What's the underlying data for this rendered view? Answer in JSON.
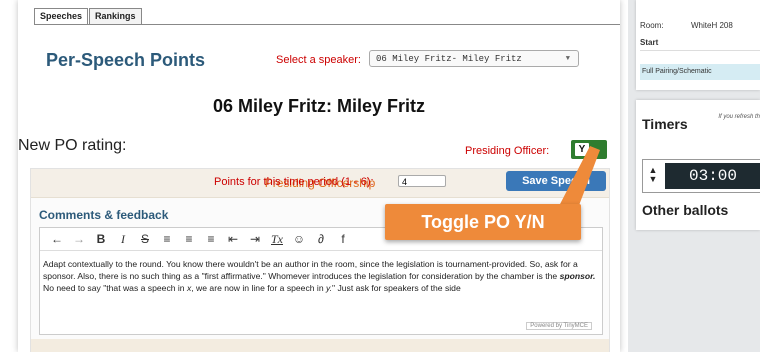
{
  "tabs": [
    {
      "label": "Speeches",
      "active": true
    },
    {
      "label": "Rankings",
      "active": false
    }
  ],
  "section_title": "Per-Speech Points",
  "speaker_select": {
    "label": "Select a speaker:",
    "value": "06 Miley Fritz- Miley Fritz"
  },
  "speech_heading": "06 Miley Fritz: Miley Fritz",
  "po_rating_label": "New PO rating:",
  "presiding_officer": {
    "label": "Presiding Officer:",
    "toggle_value": "Y",
    "color": "#2f7d2f"
  },
  "box_header": "Presiding Officership",
  "comments_label": "Comments & feedback",
  "toolbar_icons": [
    "undo-icon",
    "redo-icon",
    "bold-icon",
    "italic-icon",
    "strikethrough-icon",
    "align-left-icon",
    "align-center-icon",
    "align-right-icon",
    "outdent-icon",
    "indent-icon",
    "clear-format-icon",
    "emoji-icon",
    "link-icon",
    "image-icon"
  ],
  "toolbar_glyphs": {
    "undo": "←",
    "redo": "→",
    "bold": "B",
    "italic": "I",
    "strike": "S",
    "align_left": "≡",
    "align_center": "≡",
    "align_right": "≡",
    "outdent": "⇤",
    "indent": "⇥",
    "clear": "Tx",
    "emoji": "☺",
    "link": "∂",
    "image": "f"
  },
  "comments": {
    "p1": "Adapt contextually to the round. You know there wouldn't be an author in the room, since the legislation is tournament-provided. So, ask for a sponsor. Also, there is no such thing as a \"first affirmative.\" Whomever introduces the legislation for consideration by the chamber is the ",
    "p1_em": "sponsor.",
    "p2_a": "No need to say \"that was a speech in ",
    "p2_x": "x",
    "p2_b": ", we are now in line for a speech in ",
    "p2_y": "y.",
    "p2_c": "\" Just ask for speakers of the side"
  },
  "powered_by": "Powered by TinyMCE",
  "points": {
    "label": "Points for this time period (1 - 6):",
    "value": "4"
  },
  "save_button": "Save Speech",
  "callout": {
    "text": "Toggle PO Y/N",
    "color": "#ee8a3a"
  },
  "right_panel": {
    "room_label": "Room:",
    "room_value": "WhiteH 208",
    "start_label": "Start",
    "pairing_link": "Full Pairing/Schematic",
    "timers_title": "Timers",
    "refresh_note": "If you refresh th",
    "timer_value": "03:00",
    "other_ballots": "Other ballots"
  }
}
